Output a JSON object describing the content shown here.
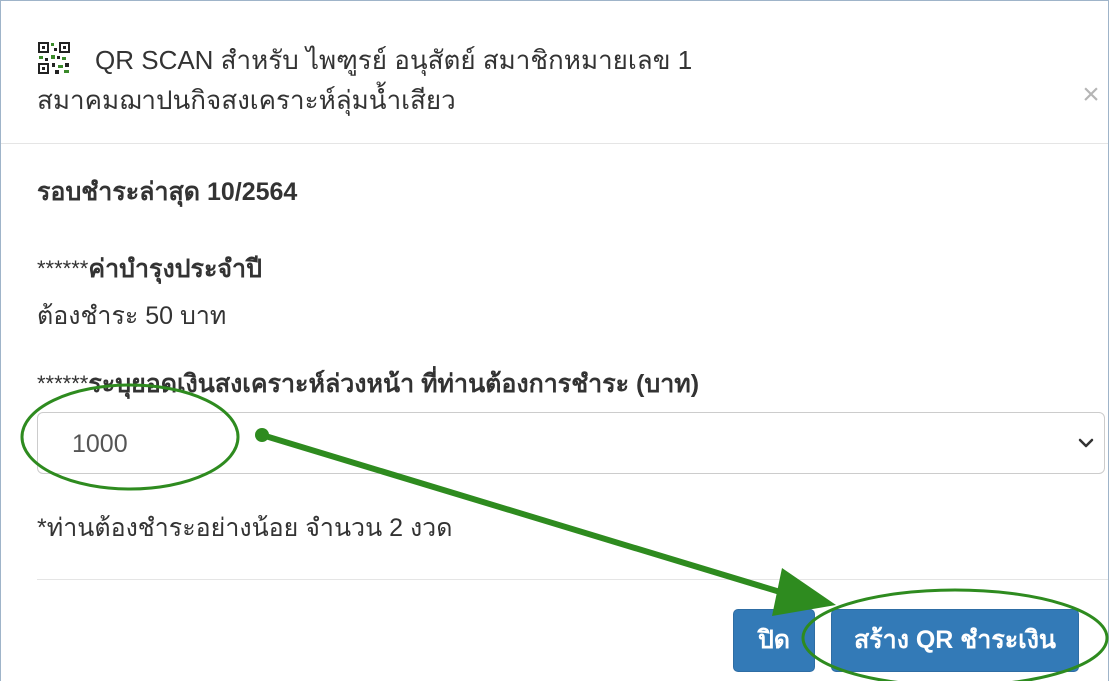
{
  "header": {
    "title_line1": "QR SCAN สำหรับ ไพฑูรย์ อนุสัตย์  สมาชิกหมายเลข 1",
    "title_line2": "สมาคมฌาปนกิจสงเคราะห์ลุ่มน้ำเสียว",
    "close_symbol": "×",
    "icon": "qr-code-icon"
  },
  "body": {
    "round_label": "รอบชำระล่าสุด 10/2564",
    "fee_stars": "******",
    "fee_label": "ค่าบำรุงประจำปี",
    "amount_text": "ต้องชำระ   50 บาท",
    "advance_stars": "******",
    "advance_label": "ระบุยอดเงินสงเคราะห์ล่วงหน้า ที่ท่านต้องการชำระ (บาท)",
    "select_value": "1000",
    "note": "*ท่านต้องชำระอย่างน้อย จำนวน 2 งวด"
  },
  "footer": {
    "close_label": "ปิด",
    "create_label": "สร้าง QR ชำระเงิน"
  },
  "colors": {
    "primary": "#337ab7",
    "annotation_green": "#2e8b1f"
  }
}
